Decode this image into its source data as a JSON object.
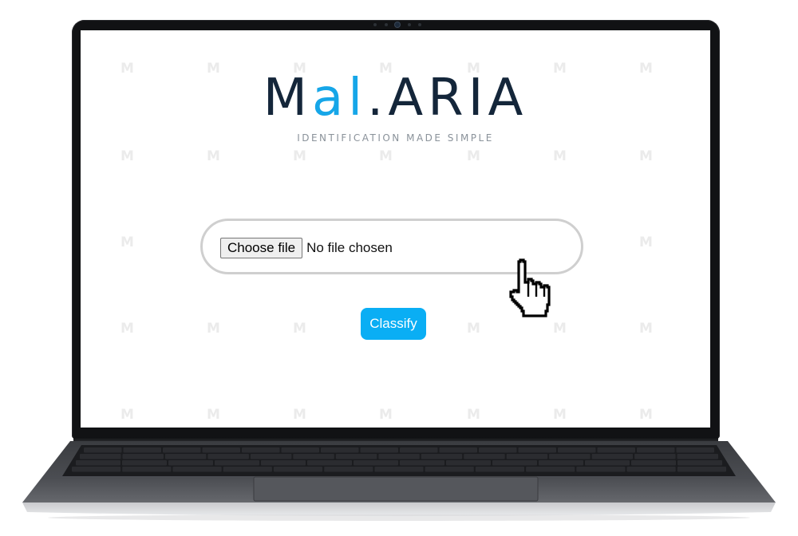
{
  "logo": {
    "part_main_1": "M",
    "part_accent": "al",
    "part_main_2": ".ARIA"
  },
  "tagline": "IDENTIFICATION MADE SIMPLE",
  "watermark_glyph": "M",
  "upload": {
    "choose_label": "Choose file",
    "status_text": "No file chosen"
  },
  "classify_label": "Classify",
  "colors": {
    "logo_dark": "#14263a",
    "logo_accent": "#16a6e8",
    "button_blue": "#0aaef4"
  },
  "icons": [
    "hand-pointer-cursor-icon",
    "laptop-camera-icon"
  ]
}
